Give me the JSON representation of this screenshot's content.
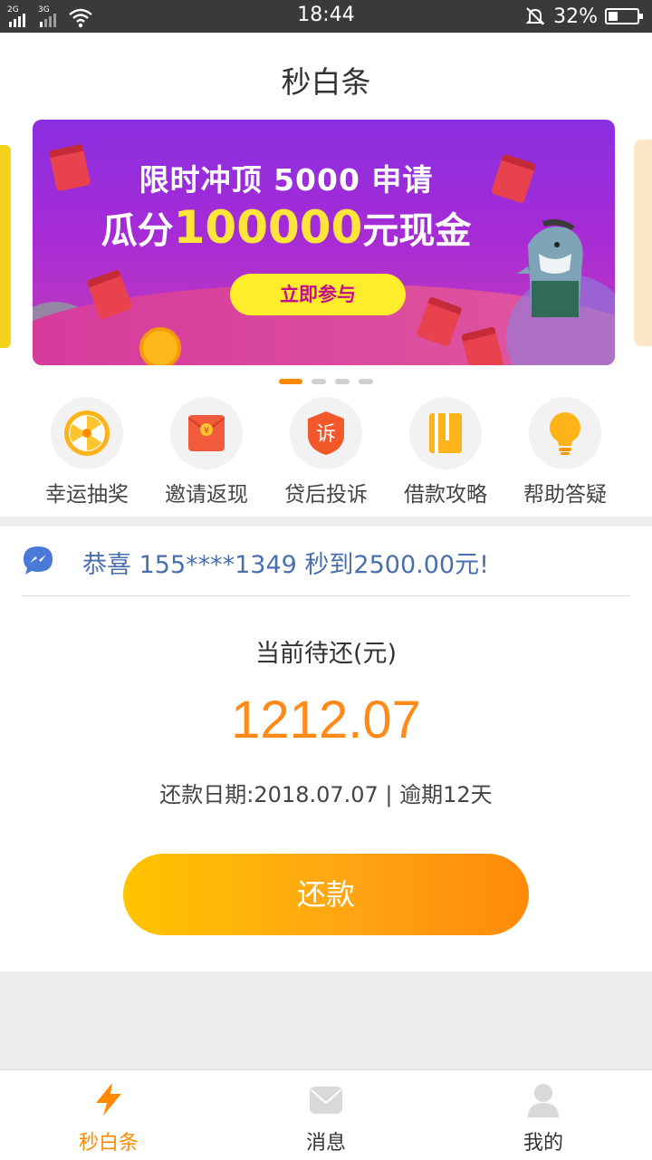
{
  "status_bar": {
    "network_1": "2G",
    "network_2": "3G",
    "time": "18:44",
    "battery_percent": "32%",
    "battery_level": 0.32
  },
  "header": {
    "title": "秒白条"
  },
  "banner": {
    "line1": "限时冲顶 5000 申请",
    "line2_prefix": "瓜分",
    "line2_highlight": "100000",
    "line2_suffix": "元现金",
    "button_label": "立即参与",
    "slide_count": 4,
    "active_slide": 1
  },
  "shortcuts": [
    {
      "label": "幸运抽奖",
      "icon": "wheel-icon"
    },
    {
      "label": "邀请返现",
      "icon": "red-envelope-icon"
    },
    {
      "label": "贷后投诉",
      "icon": "complaint-shield-icon"
    },
    {
      "label": "借款攻略",
      "icon": "guide-book-icon"
    },
    {
      "label": "帮助答疑",
      "icon": "lightbulb-icon"
    }
  ],
  "notice": {
    "text": "恭喜 155****1349 秒到2500.00元!"
  },
  "repayment": {
    "label": "当前待还(元)",
    "amount": "1212.07",
    "info": "还款日期:2018.07.07 | 逾期12天",
    "button_label": "还款"
  },
  "bottom_nav": {
    "items": [
      {
        "label": "秒白条",
        "icon": "lightning-icon",
        "active": true
      },
      {
        "label": "消息",
        "icon": "message-icon",
        "active": false
      },
      {
        "label": "我的",
        "icon": "profile-icon",
        "active": false
      }
    ]
  },
  "colors": {
    "accent": "#ff8a00",
    "notice_text": "#4a6fae",
    "banner_purple": "#8a2fe0"
  }
}
